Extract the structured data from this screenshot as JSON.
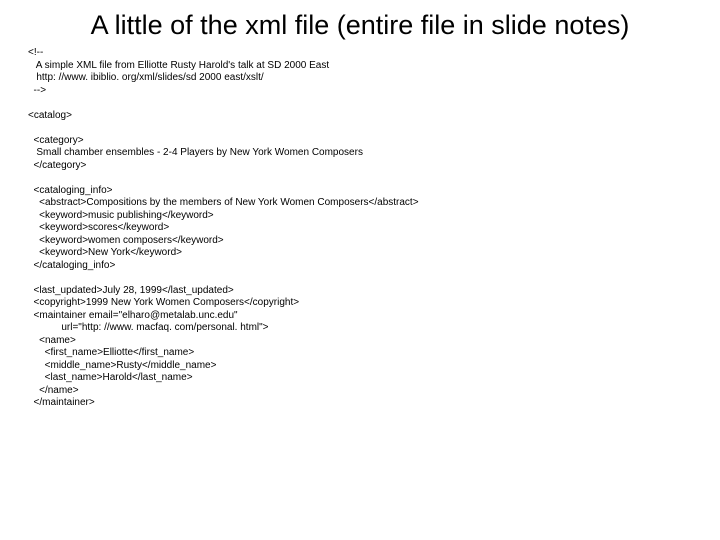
{
  "title": "A little of the xml file (entire file in slide notes)",
  "code": "<!--\n   A simple XML file from Elliotte Rusty Harold's talk at SD 2000 East\n   http: //www. ibiblio. org/xml/slides/sd 2000 east/xslt/\n  -->\n\n<catalog>\n\n  <category>\n   Small chamber ensembles - 2-4 Players by New York Women Composers\n  </category>\n\n  <cataloging_info>\n    <abstract>Compositions by the members of New York Women Composers</abstract>\n    <keyword>music publishing</keyword>\n    <keyword>scores</keyword>\n    <keyword>women composers</keyword>\n    <keyword>New York</keyword>\n  </cataloging_info>\n\n  <last_updated>July 28, 1999</last_updated>\n  <copyright>1999 New York Women Composers</copyright>\n  <maintainer email=\"elharo@metalab.unc.edu\"\n            url=\"http: //www. macfaq. com/personal. html\">\n    <name>\n      <first_name>Elliotte</first_name>\n      <middle_name>Rusty</middle_name>\n      <last_name>Harold</last_name>\n    </name>\n  </maintainer>"
}
